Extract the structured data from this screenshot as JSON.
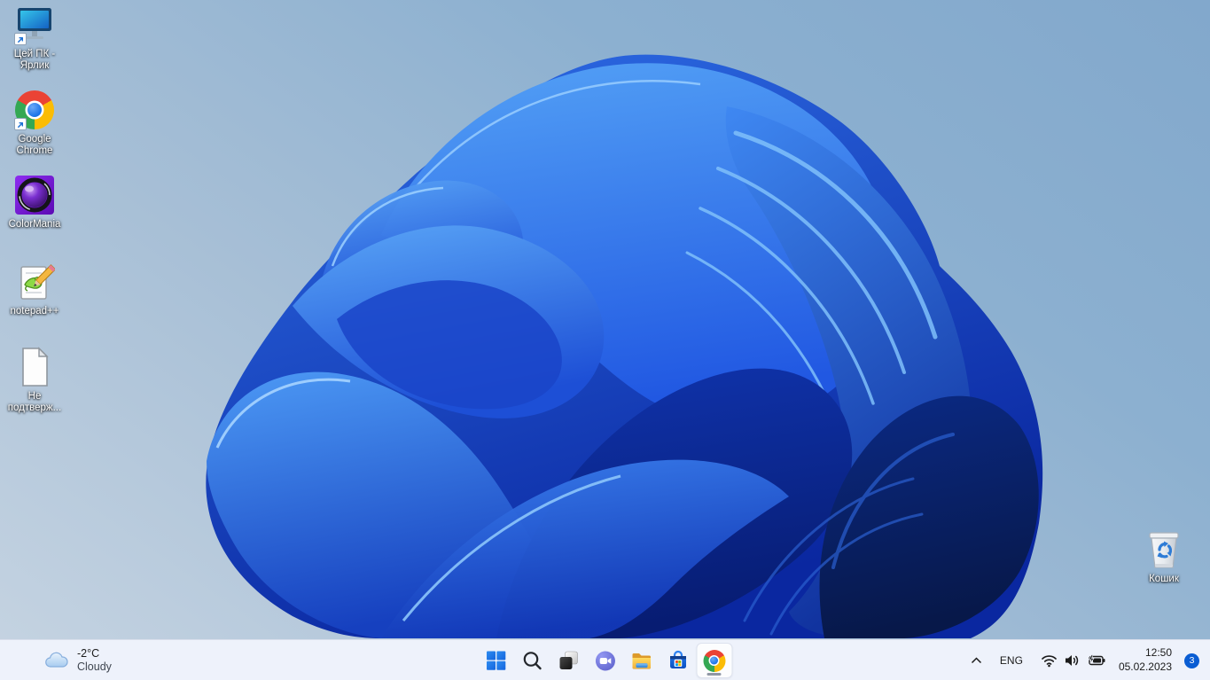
{
  "desktop": {
    "icons": [
      {
        "id": "this-pc-shortcut",
        "label": "Цей ПК - Ярлик"
      },
      {
        "id": "google-chrome",
        "label": "Google Chrome"
      },
      {
        "id": "colormania",
        "label": "ColorMania"
      },
      {
        "id": "notepad-plus-plus",
        "label": "notepad++"
      },
      {
        "id": "unconfirmed-file",
        "label": "Не подтверж..."
      }
    ],
    "recycle_bin": {
      "label": "Кошик"
    }
  },
  "taskbar": {
    "widgets": {
      "temperature": "-2°C",
      "condition": "Cloudy"
    },
    "buttons": [
      {
        "name": "start"
      },
      {
        "name": "search"
      },
      {
        "name": "task-view"
      },
      {
        "name": "chat"
      },
      {
        "name": "file-explorer"
      },
      {
        "name": "microsoft-store"
      },
      {
        "name": "chrome",
        "state": "running"
      }
    ],
    "tray": {
      "language": "ENG",
      "time": "12:50",
      "date": "05.02.2023",
      "notification_count": "3"
    }
  },
  "colors": {
    "taskbar_bg": "#eef2fb",
    "badge_blue": "#0a5dd3",
    "bloom_dark": "#0a27a0",
    "bloom_light": "#54a2f6",
    "wallpaper_top": "#82a8cc",
    "wallpaper_bottom": "#c6d4e2"
  }
}
